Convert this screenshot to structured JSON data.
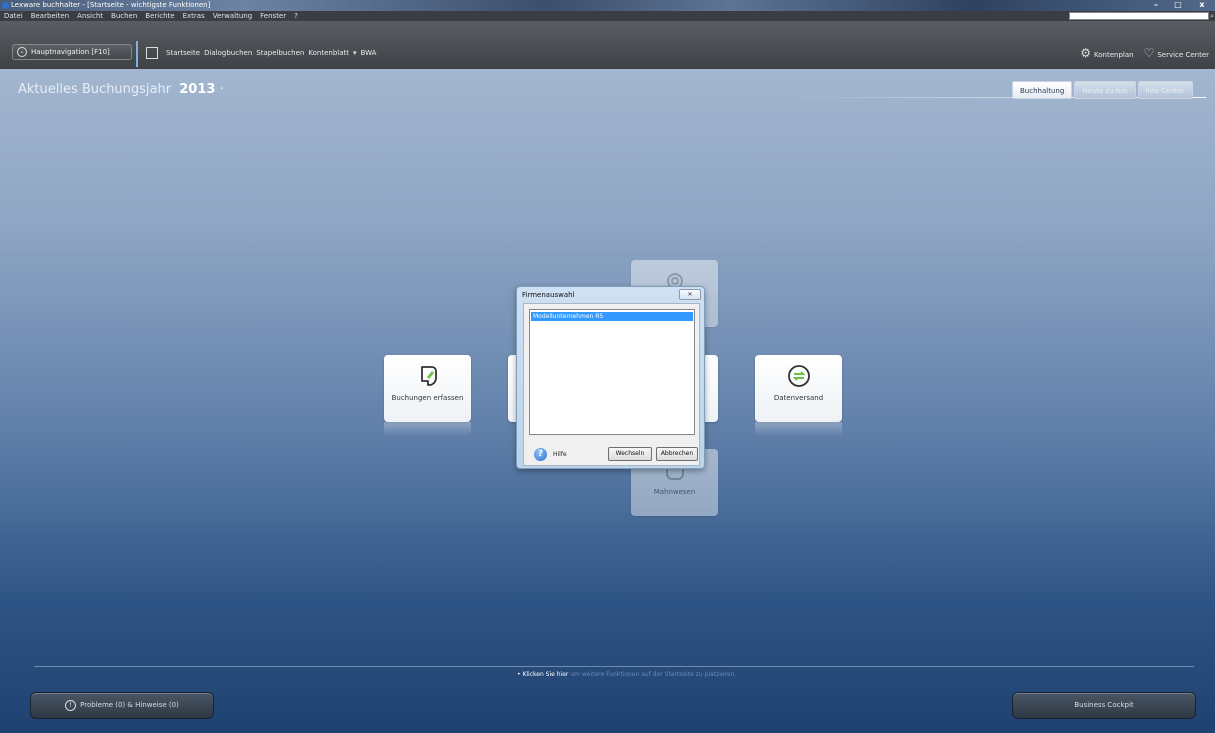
{
  "window": {
    "title": "Lexware buchhalter - [Startseite - wichtigste Funktionen]",
    "controls": [
      "–",
      "□",
      "x"
    ]
  },
  "menu": {
    "items": [
      "Datei",
      "Bearbeiten",
      "Ansicht",
      "Buchen",
      "Berichte",
      "Extras",
      "Verwaltung",
      "Fenster",
      "?"
    ]
  },
  "navbar": {
    "main_nav_label": "Hauptnavigation [F10]",
    "links": [
      "Startseite",
      "Dialogbuchen",
      "Stapelbuchen",
      "Kontenblatt",
      "BWA"
    ],
    "right": [
      {
        "icon": "gear-icon",
        "label": "Kontenplan"
      },
      {
        "icon": "bulb-icon",
        "label": "Service Center"
      }
    ]
  },
  "main": {
    "year_prefix": "Aktuelles Buchungsjahr",
    "year": "2013",
    "tabs": [
      "Buchhaltung",
      "Heute zu tun",
      "Info Center"
    ],
    "active_tab": "Buchhaltung"
  },
  "tiles": {
    "buchungen": "Buchungen erfassen",
    "datenversand": "Datenversand",
    "mahnwesen": "Mahnwesen"
  },
  "dialog": {
    "title": "Firmenauswahl",
    "list_items": [
      "Modellunternehmen RS"
    ],
    "help_label": "Hilfe",
    "switch_button": "Wechseln",
    "cancel_button": "Abbrechen"
  },
  "bottom": {
    "hint_lead": "• Klicken Sie hier",
    "hint_rest": "um weitere Funktionen auf der Startseite zu platzieren.",
    "problems_label": "Probleme (0) & Hinweise (0)",
    "cockpit_label": "Business Cockpit"
  },
  "colors": {
    "accent": "#3399ff",
    "bg_top": "#a3b6cf",
    "bg_bottom": "#1e4170",
    "tile_icon_green": "#6cc04a"
  }
}
